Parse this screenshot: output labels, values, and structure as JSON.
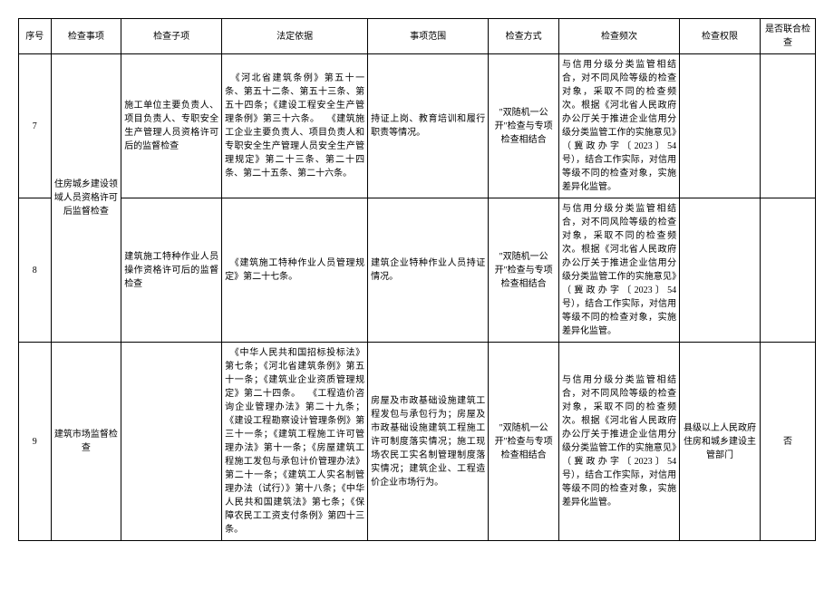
{
  "headers": {
    "seq": "序号",
    "item": "检查事项",
    "subitem": "检查子项",
    "basis": "法定依据",
    "scope": "事项范围",
    "method": "检查方式",
    "freq": "检查频次",
    "auth": "检查权限",
    "joint": "是否联合检查"
  },
  "merged": {
    "item_7_8": "住房城乡建设领域人员资格许可后监督检查"
  },
  "rows": [
    {
      "seq": "7",
      "subitem": "施工单位主要负责人、项目负责人、专职安全生产管理人员资格许可后的监督检查",
      "basis": "　《河北省建筑条例》第五十一条、第五十二条、第五十三条、第五十四条；《建设工程安全生产管理条例》第三十六条。\n　《建筑施工企业主要负责人、项目负责人和专职安全生产管理人员安全生产管理规定》第二十三条、第二十四条、第二十五条、第二十六条。",
      "scope": "持证上岗、教育培训和履行职责等情况。",
      "method": "\"双随机一公开\"检查与专项检查相结合",
      "freq": "与信用分级分类监管相结合，对不同风险等级的检查对象，采取不同的检查频次。根据《河北省人民政府办公厅关于推进企业信用分级分类监管工作的实施意见》（冀政办字〔2023〕54 号），结合工作实际，对信用等级不同的检查对象，实施差异化监管。",
      "auth": "",
      "joint": ""
    },
    {
      "seq": "8",
      "subitem": "建筑施工特种作业人员操作资格许可后的监督检查",
      "basis": "　《建筑施工特种作业人员管理规定》第二十七条。",
      "scope": "建筑企业特种作业人员持证情况。",
      "method": "\"双随机一公开\"检查与专项检查相结合",
      "freq": "与信用分级分类监管相结合，对不同风险等级的检查对象，采取不同的检查频次。根据《河北省人民政府办公厅关于推进企业信用分级分类监管工作的实施意见》（冀政办字〔2023〕54 号），结合工作实际，对信用等级不同的检查对象，实施差异化监管。",
      "auth": "",
      "joint": ""
    },
    {
      "seq": "9",
      "item": "建筑市场监督检查",
      "subitem": "",
      "basis": "　《中华人民共和国招标投标法》第七条；《河北省建筑条例》第五十一条；《建筑业企业资质管理规定》第二十四条。\n　《工程造价咨询企业管理办法》第二十九条；《建设工程勘察设计管理条例》第三十一条；《建筑工程施工许可管理办法》第十一条；《房屋建筑工程施工发包与承包计价管理办法》第二十一条；《建筑工人实名制管理办法（试行）》第十八条；《中华人民共和国建筑法》第七条；《保障农民工工资支付条例》第四十三条。",
      "scope": "房屋及市政基础设施建筑工程发包与承包行为；房屋及市政基础设施建筑工程施工许可制度落实情况；施工现场农民工实名制管理制度落实情况；建筑企业、工程造价企业市场行为。",
      "method": "\"双随机一公开\"检查与专项检查相结合",
      "freq": "与信用分级分类监管相结合，对不同风险等级的检查对象，采取不同的检查频次。根据《河北省人民政府办公厅关于推进企业信用分级分类监管工作的实施意见》（冀政办字〔2023〕54 号），结合工作实际，对信用等级不同的检查对象，实施差异化监管。",
      "auth": "县级以上人民政府住房和城乡建设主管部门",
      "joint": "否"
    }
  ]
}
